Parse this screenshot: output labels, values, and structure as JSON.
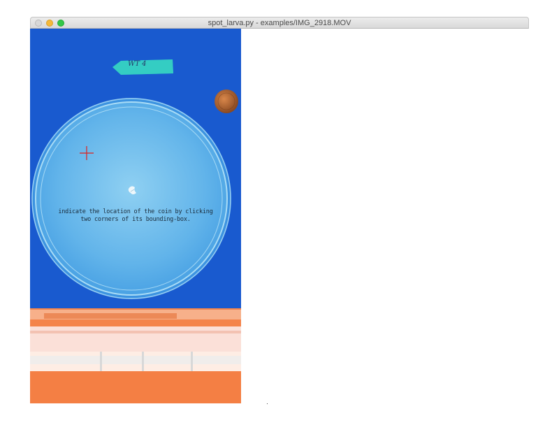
{
  "window": {
    "title": "spot_larva.py - examples/IMG_2918.MOV"
  },
  "canvas": {
    "instruction_lines": [
      "indicate the location of the coin by clicking",
      "two corners of its bounding-box."
    ],
    "dish_label": "WT 4",
    "crosshair_color": "#e0201c",
    "background_color": "#1857d0",
    "tray_color": "#f4844a"
  },
  "icons": {
    "close": "close-icon",
    "minimize": "minimize-icon",
    "maximize": "maximize-icon",
    "crosshair": "crosshair-icon",
    "coin": "coin-image",
    "larva": "larva-image"
  }
}
